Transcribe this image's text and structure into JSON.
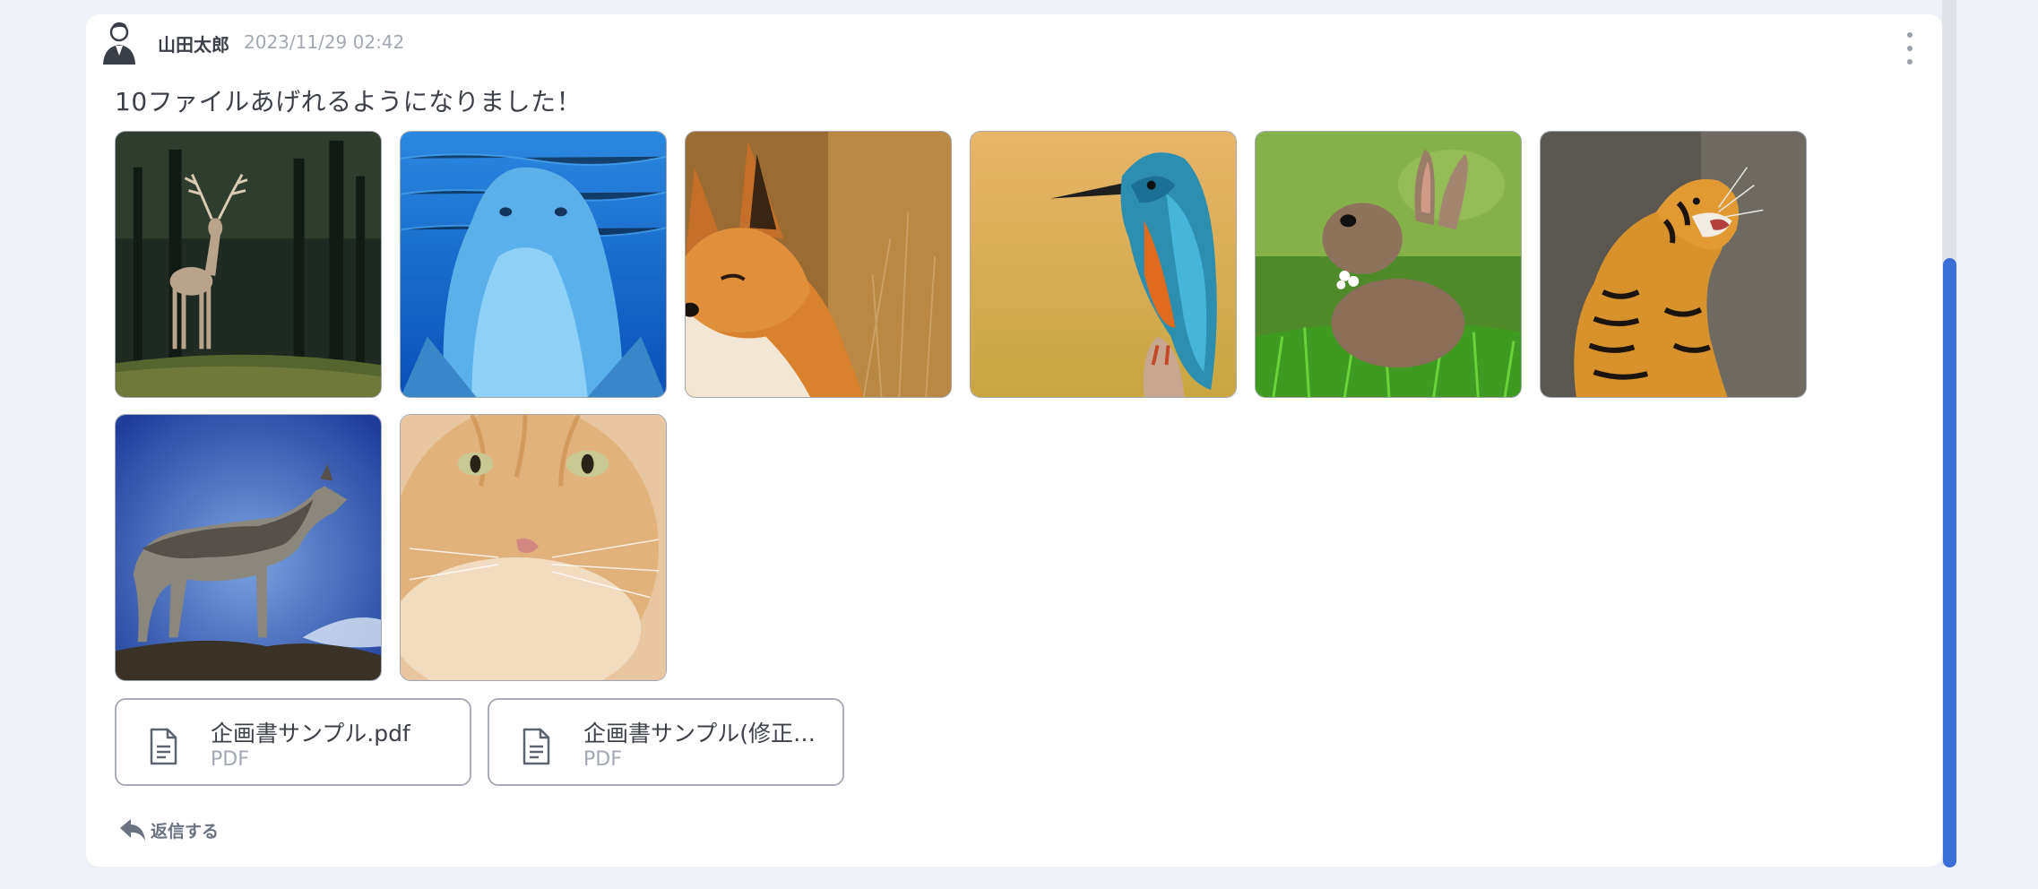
{
  "post": {
    "author": "山田太郎",
    "timestamp": "2023/11/29 02:42",
    "message": "10ファイルあげれるようになりました！",
    "menu_icon": "more-vertical-icon"
  },
  "images": [
    {
      "subject": "deer"
    },
    {
      "subject": "dolphin"
    },
    {
      "subject": "fox"
    },
    {
      "subject": "kingfisher"
    },
    {
      "subject": "rabbit"
    },
    {
      "subject": "tiger"
    },
    {
      "subject": "wolf"
    },
    {
      "subject": "cat"
    }
  ],
  "attachments": [
    {
      "name": "企画書サンプル.pdf",
      "type": "PDF",
      "icon": "document-icon"
    },
    {
      "name": "企画書サンプル(修正…",
      "type": "PDF",
      "icon": "document-icon"
    }
  ],
  "reply": {
    "label": "返信する",
    "icon": "reply-icon"
  },
  "colors": {
    "accent": "#3b6fd8",
    "background": "#eef1f8",
    "card": "#ffffff"
  }
}
